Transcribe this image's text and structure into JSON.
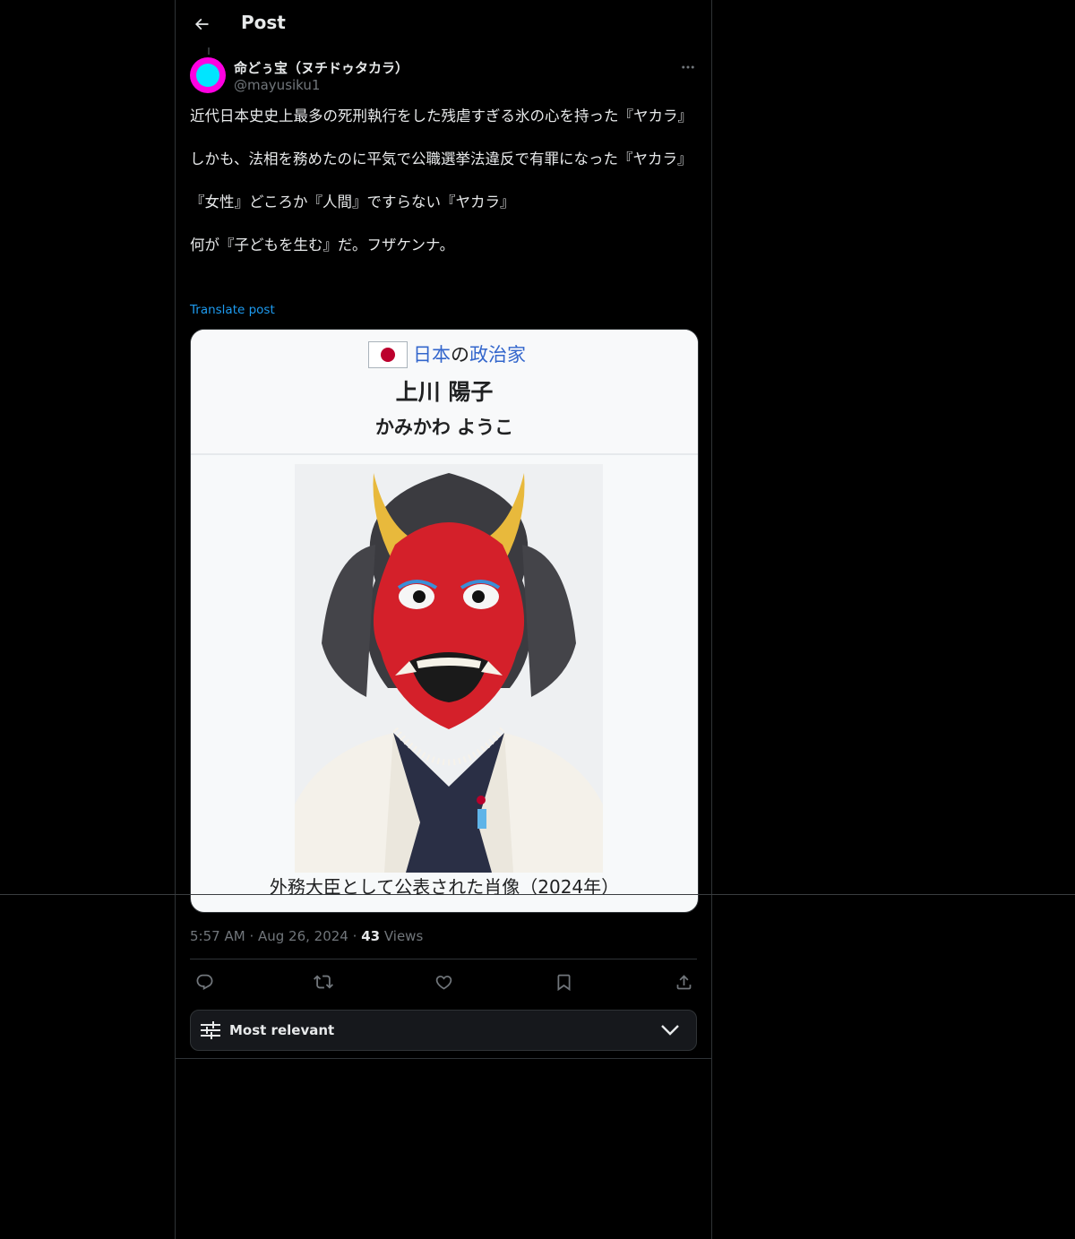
{
  "header": {
    "title": "Post",
    "back_icon": "arrow-left-icon"
  },
  "author": {
    "display_name": "命どぅ宝（ヌチドゥタカラ）",
    "handle": "@mayusiku1",
    "avatar_colors": {
      "ring": "#ff00e1",
      "center": "#00e5ff"
    }
  },
  "post": {
    "paragraphs": [
      "近代日本史史上最多の死刑執行をした残虐すぎる氷の心を持った『ヤカラ』",
      "しかも、法相を務めたのに平気で公職選挙法違反で有罪になった『ヤカラ』",
      "『女性』どころか『人間』ですらない『ヤカラ』",
      "何が『子どもを生む』だ。フザケンナ。"
    ],
    "translate_label": "Translate post"
  },
  "media": {
    "flag_caption_link1": "日本",
    "flag_caption_plain": "の",
    "flag_caption_link2": "政治家",
    "person_name": "上川 陽子",
    "person_kana": "かみかわ ようこ",
    "caption": "外務大臣として公表された肖像（2024年）"
  },
  "meta": {
    "time": "5:57 AM",
    "separator": "·",
    "date": "Aug 26, 2024",
    "views_count": "43",
    "views_label": "Views"
  },
  "actions": [
    "reply-icon",
    "repost-icon",
    "like-icon",
    "bookmark-icon",
    "share-icon"
  ],
  "sort": {
    "label": "Most relevant"
  },
  "colors": {
    "accent": "#1d9bf0",
    "text": "#e7e9ea",
    "muted": "#71767b",
    "border": "#2f3336"
  }
}
